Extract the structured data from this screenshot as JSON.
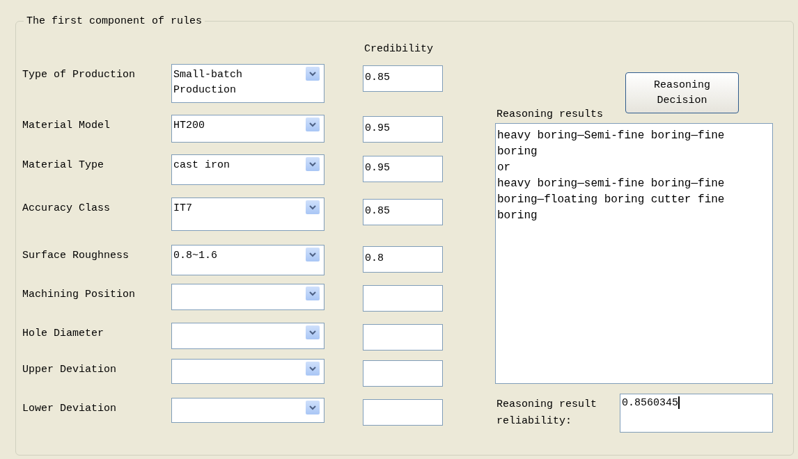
{
  "group": {
    "title": "The first component of rules"
  },
  "credibility_header": "Credibility",
  "rules": [
    {
      "label": "Type of Production",
      "value": "Small-batch Production",
      "credibility": "0.85"
    },
    {
      "label": "Material Model",
      "value": "HT200",
      "credibility": "0.95"
    },
    {
      "label": "Material Type",
      "value": "cast iron",
      "credibility": "0.95"
    },
    {
      "label": "Accuracy Class",
      "value": "IT7",
      "credibility": "0.85"
    },
    {
      "label": "Surface Roughness",
      "value": "0.8~1.6",
      "credibility": "0.8"
    },
    {
      "label": "Machining Position"
    },
    {
      "label": "Hole Diameter"
    },
    {
      "label": "Upper Deviation"
    },
    {
      "label": "Lower Deviation"
    }
  ],
  "button": "Reasoning Decision",
  "results_label": "Reasoning results",
  "results": [
    "heavy boring—Semi-fine boring—fine boring",
    "or",
    "heavy boring—semi-fine boring—fine boring—floating boring cutter fine boring"
  ],
  "reliability": {
    "label": "Reasoning result reliability:",
    "value": "0.8560345",
    "focused": true
  }
}
